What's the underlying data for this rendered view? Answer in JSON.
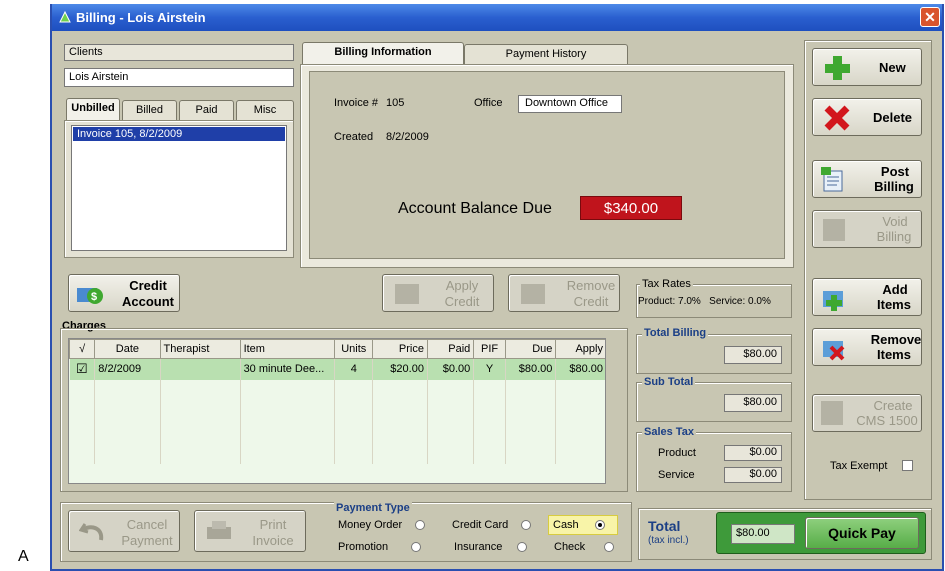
{
  "figure_label": "A",
  "window": {
    "title": "Billing - Lois Airstein",
    "close": "✕"
  },
  "clients": {
    "label": "Clients",
    "value": "Lois Airstein"
  },
  "client_tabs": [
    "Unbilled",
    "Billed",
    "Paid",
    "Misc"
  ],
  "invoice_list": [
    "Invoice 105, 8/2/2009"
  ],
  "info_tabs": [
    "Billing Information",
    "Payment History"
  ],
  "invoice": {
    "number_label": "Invoice #",
    "number": "105",
    "office_label": "Office",
    "office": "Downtown Office",
    "created_label": "Created",
    "created": "8/2/2009",
    "balance_label": "Account Balance Due",
    "balance": "$340.00"
  },
  "buttons": {
    "new": "New",
    "delete": "Delete",
    "post_billing": [
      "Post",
      "Billing"
    ],
    "void_billing": [
      "Void",
      "Billing"
    ],
    "credit_account": [
      "Credit",
      "Account"
    ],
    "apply_credit": [
      "Apply",
      "Credit"
    ],
    "remove_credit": [
      "Remove",
      "Credit"
    ],
    "add_items": [
      "Add",
      "Items"
    ],
    "remove_items": [
      "Remove",
      "Items"
    ],
    "create_cms": [
      "Create",
      "CMS 1500"
    ],
    "cancel_payment": [
      "Cancel",
      "Payment"
    ],
    "print_invoice": [
      "Print",
      "Invoice"
    ],
    "quick_pay": "Quick Pay"
  },
  "tax_rates": {
    "title": "Tax Rates",
    "text": "Product: 7.0%   Service: 0.0%"
  },
  "charges": {
    "title": "Charges",
    "columns": [
      "√",
      "Date",
      "Therapist",
      "Item",
      "Units",
      "Price",
      "Paid",
      "PIF",
      "Due",
      "Apply"
    ],
    "rows": [
      [
        "☑",
        "8/2/2009",
        "",
        "30 minute Dee...",
        "4",
        "$20.00",
        "$0.00",
        "Y",
        "$80.00",
        "$80.00"
      ]
    ]
  },
  "totals": {
    "total_billing_label": "Total Billing",
    "total_billing": "$80.00",
    "sub_total_label": "Sub Total",
    "sub_total": "$80.00",
    "sales_tax_label": "Sales Tax",
    "product_label": "Product",
    "product": "$0.00",
    "service_label": "Service",
    "service": "$0.00"
  },
  "tax_exempt": "Tax Exempt",
  "payment_type": {
    "title": "Payment Type",
    "options": [
      {
        "label": "Money Order",
        "selected": false
      },
      {
        "label": "Credit Card",
        "selected": false
      },
      {
        "label": "Cash",
        "selected": true
      },
      {
        "label": "Promotion",
        "selected": false
      },
      {
        "label": "Insurance",
        "selected": false
      },
      {
        "label": "Check",
        "selected": false
      }
    ]
  },
  "total": {
    "label": "Total",
    "sub": "(tax incl.)",
    "value": "$80.00"
  },
  "colors": {
    "balance_bg": "#c0141c",
    "row_selected": "#b9e0b0",
    "header_blue": "#1b3f86"
  }
}
